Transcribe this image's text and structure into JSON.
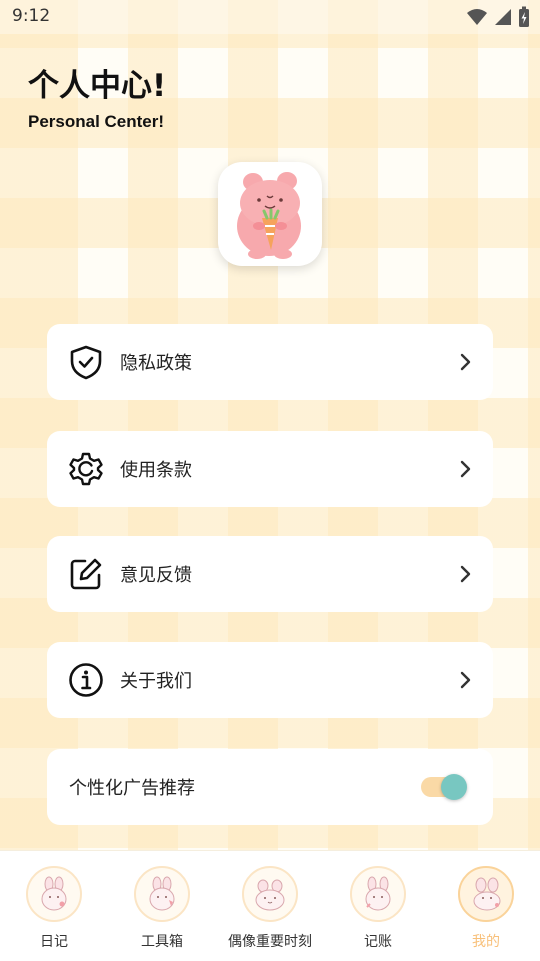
{
  "status_bar": {
    "time": "9:12",
    "icons": [
      "wifi-icon",
      "cell-signal-icon",
      "battery-charging-icon"
    ]
  },
  "header": {
    "title": "个人中心!",
    "subtitle": "Personal Center!"
  },
  "avatar": {
    "icon": "pink-bunny-carrot-avatar"
  },
  "menu": {
    "items": [
      {
        "label": "隐私政策",
        "icon": "shield-check-icon"
      },
      {
        "label": "使用条款",
        "icon": "gear-icon"
      },
      {
        "label": "意见反馈",
        "icon": "edit-icon"
      },
      {
        "label": "关于我们",
        "icon": "info-icon"
      }
    ],
    "ad_toggle": {
      "label": "个性化广告推荐",
      "on": true
    }
  },
  "tabs": [
    {
      "label": "日记",
      "active": false
    },
    {
      "label": "工具箱",
      "active": false
    },
    {
      "label": "偶像重要时刻",
      "active": false
    },
    {
      "label": "记账",
      "active": false
    },
    {
      "label": "我的",
      "active": true
    }
  ],
  "colors": {
    "accent_tab": "#f8c07a",
    "toggle_track": "#fad9a6",
    "toggle_knob": "#78c7c1",
    "gingham": "#fde9be"
  }
}
